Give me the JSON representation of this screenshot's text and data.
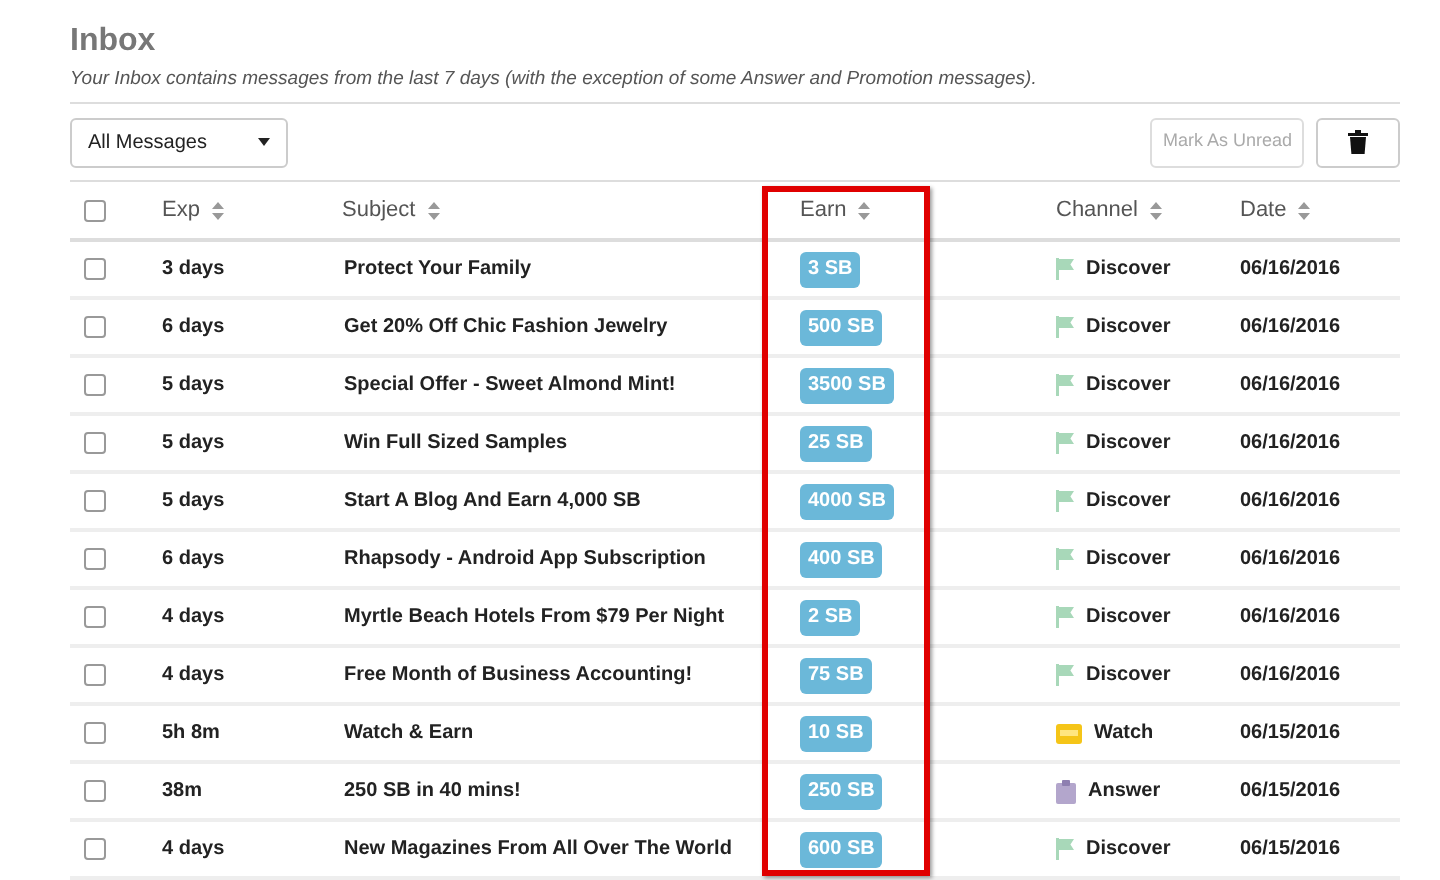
{
  "title": "Inbox",
  "subtitle": "Your Inbox contains messages from the last 7 days (with the exception of some Answer and Promotion messages).",
  "filter": {
    "value": "All Messages"
  },
  "mark_unread_button": {
    "label": "Mark As Unread",
    "disabled": true
  },
  "header": {
    "checked": false,
    "columns": [
      "Exp",
      "Subject",
      "Earn",
      "Channel",
      "Date"
    ]
  },
  "rows": [
    {
      "checked": false,
      "exp": "3 days",
      "subject": "Protect Your Family",
      "earn": "3 SB",
      "channel": {
        "kind": "discover",
        "label": "Discover"
      },
      "date": "06/16/2016"
    },
    {
      "checked": false,
      "exp": "6 days",
      "subject": "Get 20% Off Chic Fashion Jewelry",
      "earn": "500 SB",
      "channel": {
        "kind": "discover",
        "label": "Discover"
      },
      "date": "06/16/2016"
    },
    {
      "checked": false,
      "exp": "5 days",
      "subject": "Special Offer - Sweet Almond Mint!",
      "earn": "3500 SB",
      "channel": {
        "kind": "discover",
        "label": "Discover"
      },
      "date": "06/16/2016"
    },
    {
      "checked": false,
      "exp": "5 days",
      "subject": "Win Full Sized Samples",
      "earn": "25 SB",
      "channel": {
        "kind": "discover",
        "label": "Discover"
      },
      "date": "06/16/2016"
    },
    {
      "checked": false,
      "exp": "5 days",
      "subject": "Start A Blog And Earn 4,000 SB",
      "earn": "4000 SB",
      "channel": {
        "kind": "discover",
        "label": "Discover"
      },
      "date": "06/16/2016"
    },
    {
      "checked": false,
      "exp": "6 days",
      "subject": "Rhapsody - Android App Subscription",
      "earn": "400 SB",
      "channel": {
        "kind": "discover",
        "label": "Discover"
      },
      "date": "06/16/2016"
    },
    {
      "checked": false,
      "exp": "4 days",
      "subject": "Myrtle Beach Hotels From $79 Per Night",
      "earn": "2 SB",
      "channel": {
        "kind": "discover",
        "label": "Discover"
      },
      "date": "06/16/2016"
    },
    {
      "checked": false,
      "exp": "4 days",
      "subject": "Free Month of Business Accounting!",
      "earn": "75 SB",
      "channel": {
        "kind": "discover",
        "label": "Discover"
      },
      "date": "06/16/2016"
    },
    {
      "checked": false,
      "exp": "5h 8m",
      "subject": "Watch & Earn",
      "earn": "10 SB",
      "channel": {
        "kind": "watch",
        "label": "Watch"
      },
      "date": "06/15/2016"
    },
    {
      "checked": false,
      "exp": "38m",
      "subject": "250 SB in 40 mins!",
      "earn": "250 SB",
      "channel": {
        "kind": "answer",
        "label": "Answer"
      },
      "date": "06/15/2016"
    },
    {
      "checked": false,
      "exp": "4 days",
      "subject": "New Magazines From All Over The World",
      "earn": "600 SB",
      "channel": {
        "kind": "discover",
        "label": "Discover"
      },
      "date": "06/15/2016"
    }
  ]
}
